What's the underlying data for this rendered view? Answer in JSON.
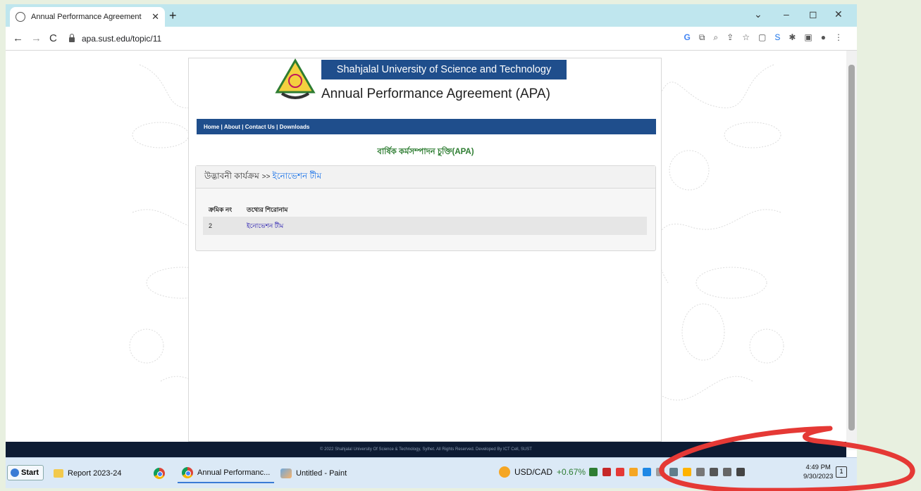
{
  "browser": {
    "tab_title": "Annual Performance Agreement",
    "tab_close": "✕",
    "new_tab": "+",
    "url": "apa.sust.edu/topic/11",
    "win_min": "–",
    "win_max": "◻",
    "win_close": "✕",
    "win_menu": "⌄"
  },
  "site": {
    "university": "Shahjalal University of Science and Technology",
    "title": "Annual Performance Agreement (APA)",
    "nav": [
      "Home",
      "About",
      "Contact Us",
      "Downloads"
    ],
    "heading_bn": "বার্ষিক কর্মসম্পাদন চুক্তি(APA)",
    "breadcrumb_parent": "উদ্ভাবনী কার্যক্রম",
    "breadcrumb_sep": ">>",
    "breadcrumb_current": "ইনোভেশন টীম",
    "table": {
      "headers": [
        "ক্রমিক নং",
        "তথ্যের শিরোনাম"
      ],
      "rows": [
        {
          "serial": "2",
          "title": "ইনোভেশন টীম"
        }
      ]
    },
    "footer": "© 2022 Shahjalal University Of Science & Technology, Sylhet. All Rights Reserved. Developed By ICT Cell, SUST"
  },
  "taskbar": {
    "start": "Start",
    "items": [
      "Report 2023-24",
      "Annual Performanc...",
      "Untitled - Paint"
    ],
    "ticker_symbol": "USD/CAD",
    "ticker_change": "+0.67%",
    "time": "4:49 PM",
    "date": "9/30/2023",
    "notifications": "1"
  },
  "colors": {
    "nav_blue": "#1f4e8c",
    "accent_green": "#2e7d32",
    "annotation_red": "#e53935",
    "tab_strip": "#bfe6ee"
  }
}
